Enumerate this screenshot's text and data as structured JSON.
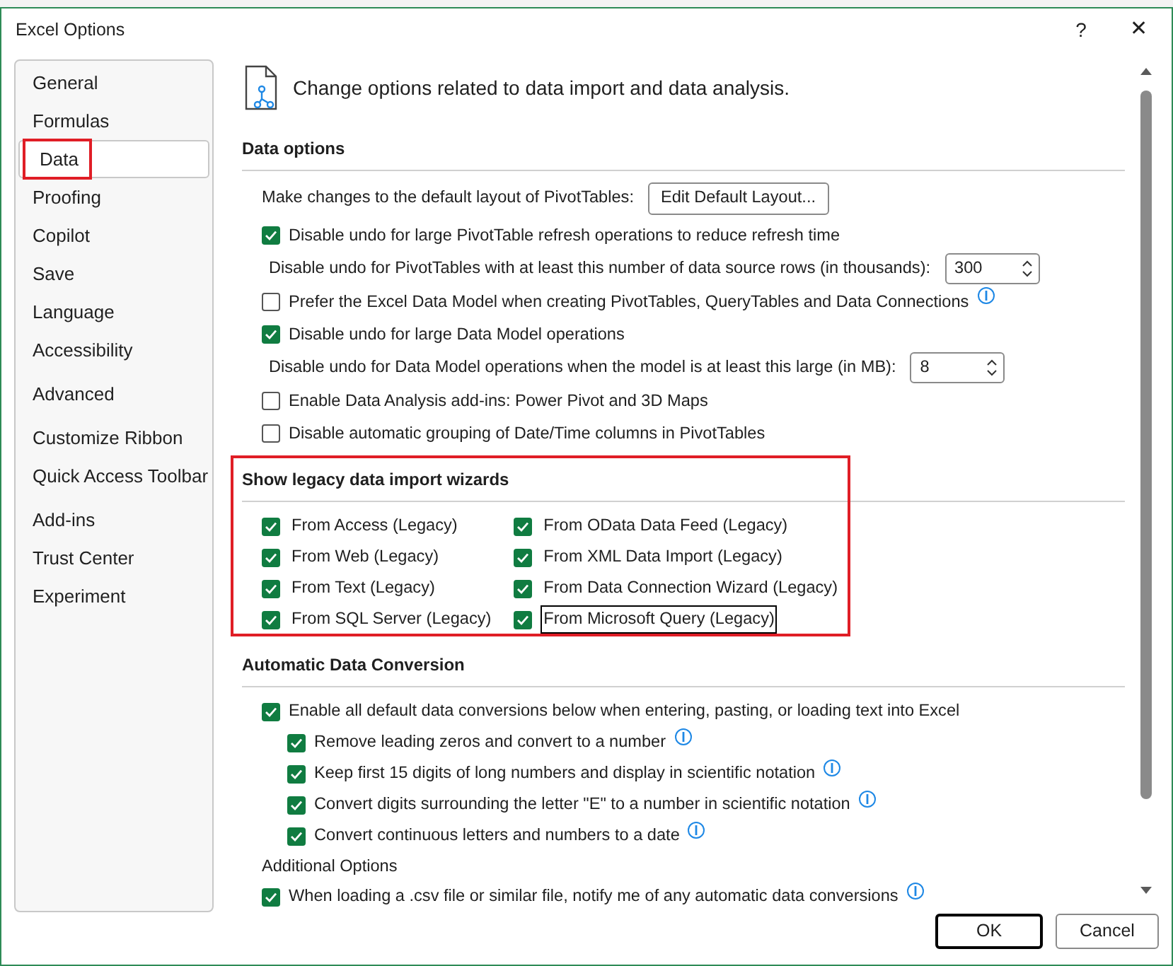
{
  "window": {
    "title": "Excel Options",
    "help": "?",
    "close": "✕"
  },
  "sidebar": {
    "groups": [
      [
        {
          "label": "General",
          "selected": false,
          "highlighted": false
        },
        {
          "label": "Formulas",
          "selected": false,
          "highlighted": false
        },
        {
          "label": "Data",
          "selected": true,
          "highlighted": true
        },
        {
          "label": "Proofing",
          "selected": false,
          "highlighted": false
        },
        {
          "label": "Copilot",
          "selected": false,
          "highlighted": false
        },
        {
          "label": "Save",
          "selected": false,
          "highlighted": false
        },
        {
          "label": "Language",
          "selected": false,
          "highlighted": false
        },
        {
          "label": "Accessibility",
          "selected": false,
          "highlighted": false
        }
      ],
      [
        {
          "label": "Advanced",
          "selected": false,
          "highlighted": false
        }
      ],
      [
        {
          "label": "Customize Ribbon",
          "selected": false,
          "highlighted": false
        },
        {
          "label": "Quick Access Toolbar",
          "selected": false,
          "highlighted": false
        }
      ],
      [
        {
          "label": "Add-ins",
          "selected": false,
          "highlighted": false
        },
        {
          "label": "Trust Center",
          "selected": false,
          "highlighted": false
        },
        {
          "label": "Experiment",
          "selected": false,
          "highlighted": false
        }
      ]
    ]
  },
  "header": "Change options related to data import and data analysis.",
  "sections": [
    {
      "title": "Data options",
      "highlighted": false,
      "items": [
        {
          "kind": "button_row",
          "label": "Make changes to the default layout of PivotTables:",
          "button": "Edit Default Layout..."
        },
        {
          "kind": "checkbox",
          "label": "Disable undo for large PivotTable refresh operations to reduce refresh time",
          "checked": true
        },
        {
          "kind": "spin",
          "label": "Disable undo for PivotTables with at least this number of data source rows (in thousands):",
          "value": "300"
        },
        {
          "kind": "checkbox",
          "label": "Prefer the Excel Data Model when creating PivotTables, QueryTables and Data Connections",
          "checked": false,
          "info": true
        },
        {
          "kind": "checkbox",
          "label": "Disable undo for large Data Model operations",
          "checked": true
        },
        {
          "kind": "spin",
          "label": "Disable undo for Data Model operations when the model is at least this large (in MB):",
          "value": "8"
        },
        {
          "kind": "checkbox",
          "label": "Enable Data Analysis add-ins: Power Pivot and 3D Maps",
          "checked": false
        },
        {
          "kind": "checkbox",
          "label": "Disable automatic grouping of Date/Time columns in PivotTables",
          "checked": false
        }
      ]
    },
    {
      "title": "Show legacy data import wizards",
      "highlighted": true,
      "columns": [
        [
          {
            "label": "From Access (Legacy)",
            "checked": true,
            "focused": false
          },
          {
            "label": "From Web (Legacy)",
            "checked": true,
            "focused": false
          },
          {
            "label": "From Text (Legacy)",
            "checked": true,
            "focused": false
          },
          {
            "label": "From SQL Server (Legacy)",
            "checked": true,
            "focused": false
          }
        ],
        [
          {
            "label": "From OData Data Feed (Legacy)",
            "checked": true,
            "focused": false
          },
          {
            "label": "From XML Data Import (Legacy)",
            "checked": true,
            "focused": false
          },
          {
            "label": "From Data Connection Wizard (Legacy)",
            "checked": true,
            "focused": false
          },
          {
            "label": "From Microsoft Query (Legacy)",
            "checked": true,
            "focused": true
          }
        ]
      ]
    },
    {
      "title": "Automatic Data Conversion",
      "highlighted": false,
      "items": [
        {
          "kind": "checkbox",
          "label": "Enable all default data conversions below when entering, pasting, or loading text into Excel",
          "checked": true,
          "children": [
            {
              "kind": "checkbox",
              "label": "Remove leading zeros and convert to a number",
              "checked": true,
              "info": true
            },
            {
              "kind": "checkbox",
              "label": "Keep first 15 digits of long numbers and display in scientific notation",
              "checked": true,
              "info": true
            },
            {
              "kind": "checkbox",
              "label": "Convert digits surrounding the letter \"E\" to a number in scientific notation",
              "checked": true,
              "info": true
            },
            {
              "kind": "checkbox",
              "label": "Convert continuous letters and numbers to a date",
              "checked": true,
              "info": true
            }
          ]
        },
        {
          "kind": "label",
          "label": "Additional Options"
        },
        {
          "kind": "checkbox",
          "label": "When loading a .csv file or similar file, notify me of any automatic data conversions",
          "checked": true,
          "info": true
        }
      ]
    }
  ],
  "buttons": [
    {
      "label": "OK",
      "default": true
    },
    {
      "label": "Cancel",
      "default": false
    }
  ]
}
